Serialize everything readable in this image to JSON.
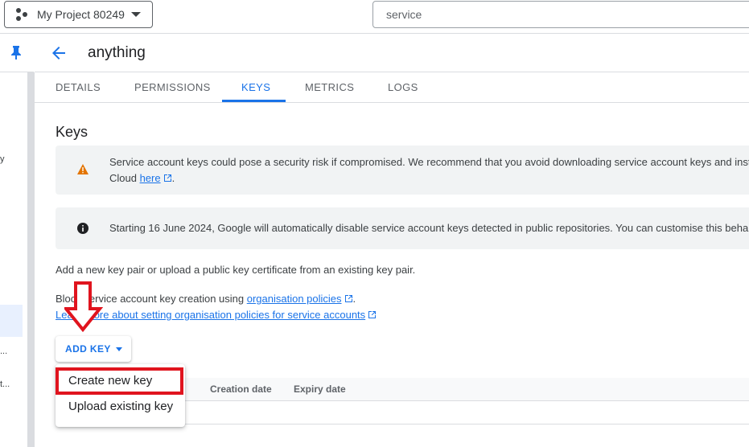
{
  "topbar": {
    "project_name": "My Project 80249",
    "search_value": "service"
  },
  "leftrail": {
    "fragments": [
      "y",
      "...",
      "t..."
    ]
  },
  "header": {
    "title": "anything"
  },
  "tabs": [
    {
      "label": "DETAILS",
      "active": false
    },
    {
      "label": "PERMISSIONS",
      "active": false
    },
    {
      "label": "KEYS",
      "active": true
    },
    {
      "label": "METRICS",
      "active": false
    },
    {
      "label": "LOGS",
      "active": false
    }
  ],
  "keys": {
    "title": "Keys",
    "warning": {
      "line1": "Service account keys could pose a security risk if compromised. We recommend that you avoid downloading service account keys and inst",
      "line2_prefix": "Cloud ",
      "link": "here",
      "line2_suffix": "."
    },
    "info": {
      "text": "Starting 16 June 2024, Google will automatically disable service account keys detected in public repositories. You can customise this beha"
    },
    "description": "Add a new key pair or upload a public key certificate from an existing key pair.",
    "block_prefix": "Block service account key creation using ",
    "block_link": "organisation policies",
    "block_suffix": ".",
    "learn_more_link": "Learn more about setting organisation policies for service accounts",
    "add_key_label": "ADD KEY",
    "table_headers": [
      "Creation date",
      "Expiry date"
    ],
    "menu_items": [
      "Create new key",
      "Upload existing key"
    ]
  },
  "colors": {
    "accent": "#1a73e8",
    "warning": "#e37400",
    "annotation": "#e0141e"
  },
  "icons": {
    "project": "project-nodes-icon",
    "pin": "pin-icon",
    "back": "arrow-back-icon",
    "warning": "warning-triangle-icon",
    "info": "info-circle-icon",
    "external": "external-link-icon"
  }
}
